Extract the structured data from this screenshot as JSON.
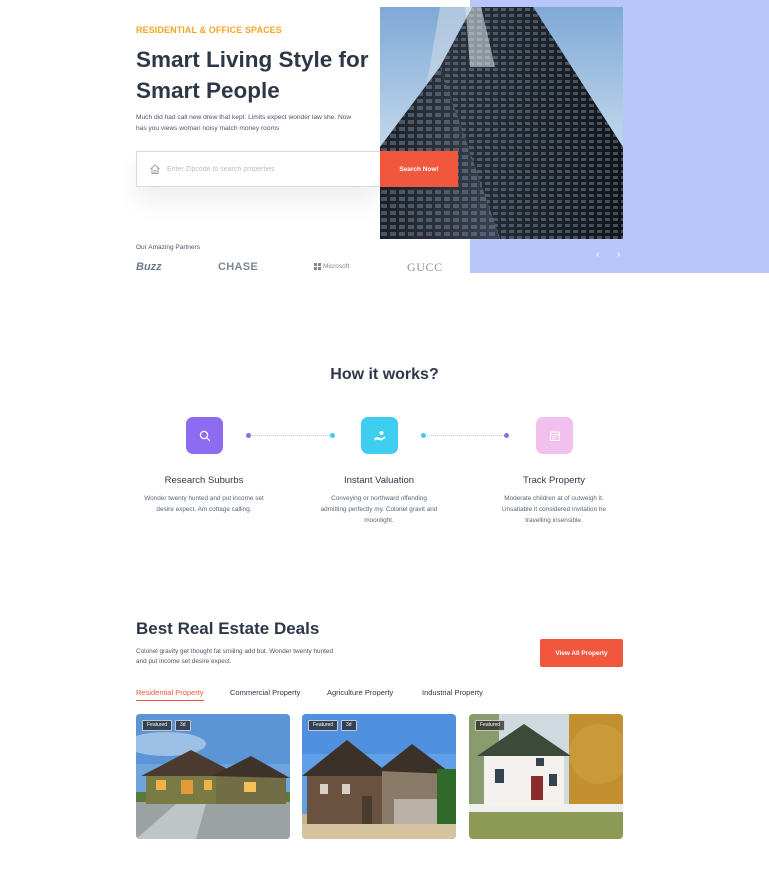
{
  "hero": {
    "eyebrow": "RESIDENTIAL & OFFICE SPACES",
    "title": "Smart Living Style for Smart People",
    "description": "Much did had call new drew that kept. Limits expect wonder law she. Now has you views woman noisy match money rooms",
    "search_placeholder": "Enter Zipcode to search properties",
    "search_button": "Search Now!",
    "partners_label": "Our Amazing Partners",
    "partners": [
      "Buzz",
      "CHASE",
      "Microsoft",
      "GUCC"
    ],
    "prev_arrow": "‹",
    "next_arrow": "›"
  },
  "how_it_works": {
    "title": "How it works?",
    "steps": [
      {
        "title": "Research Suburbs",
        "description": "Wonder twenty hunted and put income set desire expect. Am cottage calling.",
        "icon": "search-icon",
        "color": "#8f6bf2"
      },
      {
        "title": "Instant Valuation",
        "description": "Conveying or northward offending admitting perfectly my. Colonel gravit and moonlight.",
        "icon": "hand-coins-icon",
        "color": "#3fcdf0"
      },
      {
        "title": "Track Property",
        "description": "Moderate children at of outweigh it. Unsatiable it considered invitation he travelling insensible.",
        "icon": "calendar-icon",
        "color": "#f1c0ee"
      }
    ]
  },
  "deals": {
    "title": "Best Real Estate Deals",
    "description": "Colonel gravity get thought fat smiling add but. Wonder twenty hunted and put income set desire expect.",
    "view_all": "View All Property",
    "tabs": [
      "Residential Property",
      "Commercial Property",
      "Agriculture Property",
      "Industrial Property"
    ],
    "active_tab": 0,
    "cards": [
      {
        "badges": [
          "Featured",
          "3d"
        ]
      },
      {
        "badges": [
          "Featured",
          "3d"
        ]
      },
      {
        "badges": [
          "Featured"
        ]
      }
    ]
  },
  "colors": {
    "accent": "#f0573d",
    "eyebrow": "#f5a623",
    "hero_panel": "#b8c6fb"
  }
}
